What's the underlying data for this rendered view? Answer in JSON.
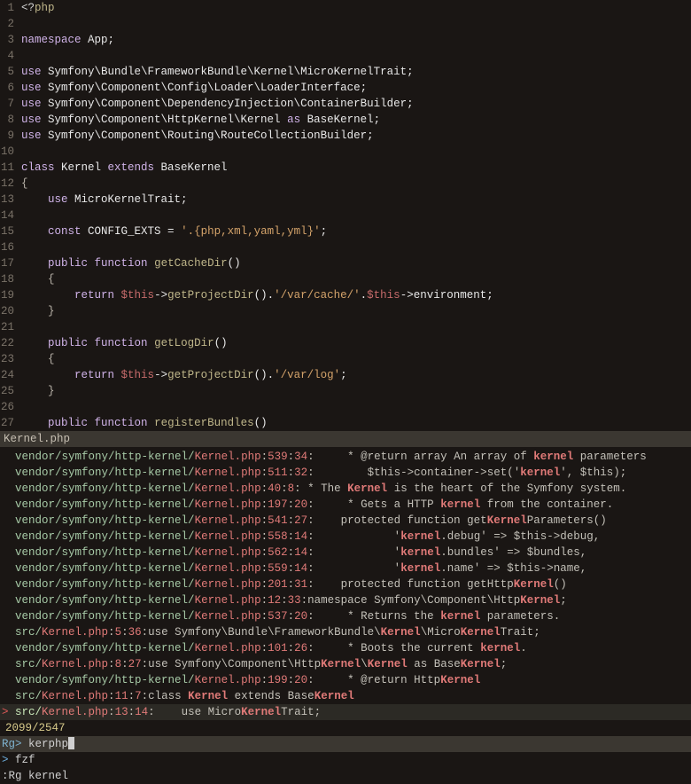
{
  "editor": {
    "lines": [
      {
        "n": "1",
        "segs": [
          {
            "c": "p",
            "t": "<?"
          },
          {
            "c": "fn",
            "t": "php"
          }
        ]
      },
      {
        "n": "2",
        "segs": []
      },
      {
        "n": "3",
        "segs": [
          {
            "c": "k",
            "t": "namespace"
          },
          {
            "c": "v",
            "t": " App;"
          }
        ]
      },
      {
        "n": "4",
        "segs": []
      },
      {
        "n": "5",
        "segs": [
          {
            "c": "k",
            "t": "use"
          },
          {
            "c": "v",
            "t": " Symfony\\Bundle\\FrameworkBundle\\Kernel\\MicroKernelTrait;"
          }
        ]
      },
      {
        "n": "6",
        "segs": [
          {
            "c": "k",
            "t": "use"
          },
          {
            "c": "v",
            "t": " Symfony\\Component\\Config\\Loader\\LoaderInterface;"
          }
        ]
      },
      {
        "n": "7",
        "segs": [
          {
            "c": "k",
            "t": "use"
          },
          {
            "c": "v",
            "t": " Symfony\\Component\\DependencyInjection\\ContainerBuilder;"
          }
        ]
      },
      {
        "n": "8",
        "segs": [
          {
            "c": "k",
            "t": "use"
          },
          {
            "c": "v",
            "t": " Symfony\\Component\\HttpKernel\\Kernel "
          },
          {
            "c": "k",
            "t": "as"
          },
          {
            "c": "v",
            "t": " BaseKernel;"
          }
        ]
      },
      {
        "n": "9",
        "segs": [
          {
            "c": "k",
            "t": "use"
          },
          {
            "c": "v",
            "t": " Symfony\\Component\\Routing\\RouteCollectionBuilder;"
          }
        ]
      },
      {
        "n": "10",
        "segs": []
      },
      {
        "n": "11",
        "segs": [
          {
            "c": "k",
            "t": "class"
          },
          {
            "c": "v",
            "t": " Kernel "
          },
          {
            "c": "k",
            "t": "extends"
          },
          {
            "c": "v",
            "t": " BaseKernel"
          }
        ]
      },
      {
        "n": "12",
        "segs": [
          {
            "c": "br",
            "t": "{"
          }
        ]
      },
      {
        "n": "13",
        "segs": [
          {
            "c": "v",
            "t": "    "
          },
          {
            "c": "k",
            "t": "use"
          },
          {
            "c": "v",
            "t": " MicroKernelTrait;"
          }
        ]
      },
      {
        "n": "14",
        "segs": []
      },
      {
        "n": "15",
        "segs": [
          {
            "c": "v",
            "t": "    "
          },
          {
            "c": "k",
            "t": "const"
          },
          {
            "c": "v",
            "t": " CONFIG_EXTS = "
          },
          {
            "c": "s",
            "t": "'.{php,xml,yaml,yml}'"
          },
          {
            "c": "v",
            "t": ";"
          }
        ]
      },
      {
        "n": "16",
        "segs": []
      },
      {
        "n": "17",
        "segs": [
          {
            "c": "v",
            "t": "    "
          },
          {
            "c": "k",
            "t": "public"
          },
          {
            "c": "v",
            "t": " "
          },
          {
            "c": "k",
            "t": "function"
          },
          {
            "c": "v",
            "t": " "
          },
          {
            "c": "fn",
            "t": "getCacheDir"
          },
          {
            "c": "v",
            "t": "()"
          }
        ]
      },
      {
        "n": "18",
        "segs": [
          {
            "c": "v",
            "t": "    "
          },
          {
            "c": "br",
            "t": "{"
          }
        ]
      },
      {
        "n": "19",
        "segs": [
          {
            "c": "v",
            "t": "        "
          },
          {
            "c": "k",
            "t": "return"
          },
          {
            "c": "v",
            "t": " "
          },
          {
            "c": "vr",
            "t": "$this"
          },
          {
            "c": "v",
            "t": "->"
          },
          {
            "c": "fn",
            "t": "getProjectDir"
          },
          {
            "c": "v",
            "t": "()."
          },
          {
            "c": "s",
            "t": "'/var/cache/'"
          },
          {
            "c": "v",
            "t": "."
          },
          {
            "c": "vr",
            "t": "$this"
          },
          {
            "c": "v",
            "t": "->environment;"
          }
        ]
      },
      {
        "n": "20",
        "segs": [
          {
            "c": "v",
            "t": "    "
          },
          {
            "c": "br",
            "t": "}"
          }
        ]
      },
      {
        "n": "21",
        "segs": []
      },
      {
        "n": "22",
        "segs": [
          {
            "c": "v",
            "t": "    "
          },
          {
            "c": "k",
            "t": "public"
          },
          {
            "c": "v",
            "t": " "
          },
          {
            "c": "k",
            "t": "function"
          },
          {
            "c": "v",
            "t": " "
          },
          {
            "c": "fn",
            "t": "getLogDir"
          },
          {
            "c": "v",
            "t": "()"
          }
        ]
      },
      {
        "n": "23",
        "segs": [
          {
            "c": "v",
            "t": "    "
          },
          {
            "c": "br",
            "t": "{"
          }
        ]
      },
      {
        "n": "24",
        "segs": [
          {
            "c": "v",
            "t": "        "
          },
          {
            "c": "k",
            "t": "return"
          },
          {
            "c": "v",
            "t": " "
          },
          {
            "c": "vr",
            "t": "$this"
          },
          {
            "c": "v",
            "t": "->"
          },
          {
            "c": "fn",
            "t": "getProjectDir"
          },
          {
            "c": "v",
            "t": "()."
          },
          {
            "c": "s",
            "t": "'/var/log'"
          },
          {
            "c": "v",
            "t": ";"
          }
        ]
      },
      {
        "n": "25",
        "segs": [
          {
            "c": "v",
            "t": "    "
          },
          {
            "c": "br",
            "t": "}"
          }
        ]
      },
      {
        "n": "26",
        "segs": []
      },
      {
        "n": "27",
        "segs": [
          {
            "c": "v",
            "t": "    "
          },
          {
            "c": "k",
            "t": "public"
          },
          {
            "c": "v",
            "t": " "
          },
          {
            "c": "k",
            "t": "function"
          },
          {
            "c": "v",
            "t": " "
          },
          {
            "c": "fn",
            "t": "registerBundles"
          },
          {
            "c": "v",
            "t": "()"
          }
        ]
      }
    ]
  },
  "filebar": "Kernel.php",
  "results": [
    {
      "dir": "vendor/symfony/http-kernel/",
      "file": "Kernel.php",
      "ln": "539",
      "col": "34",
      "segs": [
        {
          "t": "     * @return array An array of "
        },
        {
          "h": true,
          "t": "kernel"
        },
        {
          "t": " parameters"
        }
      ]
    },
    {
      "dir": "vendor/symfony/http-kernel/",
      "file": "Kernel.php",
      "ln": "511",
      "col": "32",
      "segs": [
        {
          "t": "        $this->container->set('"
        },
        {
          "h": true,
          "t": "kernel"
        },
        {
          "t": "', $this);"
        }
      ]
    },
    {
      "dir": "vendor/symfony/http-kernel/",
      "file": "Kernel.php",
      "ln": "40",
      "col": "8",
      "segs": [
        {
          "t": " * The "
        },
        {
          "h": true,
          "t": "Kernel"
        },
        {
          "t": " is the heart of the Symfony system."
        }
      ]
    },
    {
      "dir": "vendor/symfony/http-kernel/",
      "file": "Kernel.php",
      "ln": "197",
      "col": "20",
      "segs": [
        {
          "t": "     * Gets a HTTP "
        },
        {
          "h": true,
          "t": "kernel"
        },
        {
          "t": " from the container."
        }
      ]
    },
    {
      "dir": "vendor/symfony/http-kernel/",
      "file": "Kernel.php",
      "ln": "541",
      "col": "27",
      "segs": [
        {
          "t": "    protected function get"
        },
        {
          "h": true,
          "t": "Kernel"
        },
        {
          "t": "Parameters()"
        }
      ]
    },
    {
      "dir": "vendor/symfony/http-kernel/",
      "file": "Kernel.php",
      "ln": "558",
      "col": "14",
      "segs": [
        {
          "t": "            '"
        },
        {
          "h": true,
          "t": "kernel"
        },
        {
          "t": ".debug' => $this->debug,"
        }
      ]
    },
    {
      "dir": "vendor/symfony/http-kernel/",
      "file": "Kernel.php",
      "ln": "562",
      "col": "14",
      "segs": [
        {
          "t": "            '"
        },
        {
          "h": true,
          "t": "kernel"
        },
        {
          "t": ".bundles' => $bundles,"
        }
      ]
    },
    {
      "dir": "vendor/symfony/http-kernel/",
      "file": "Kernel.php",
      "ln": "559",
      "col": "14",
      "segs": [
        {
          "t": "            '"
        },
        {
          "h": true,
          "t": "kernel"
        },
        {
          "t": ".name' => $this->name,"
        }
      ]
    },
    {
      "dir": "vendor/symfony/http-kernel/",
      "file": "Kernel.php",
      "ln": "201",
      "col": "31",
      "segs": [
        {
          "t": "    protected function getHttp"
        },
        {
          "h": true,
          "t": "Kernel"
        },
        {
          "t": "()"
        }
      ]
    },
    {
      "dir": "vendor/symfony/http-kernel/",
      "file": "Kernel.php",
      "ln": "12",
      "col": "33",
      "segs": [
        {
          "t": "namespace Symfony\\Component\\Http"
        },
        {
          "h": true,
          "t": "Kernel"
        },
        {
          "t": ";"
        }
      ]
    },
    {
      "dir": "vendor/symfony/http-kernel/",
      "file": "Kernel.php",
      "ln": "537",
      "col": "20",
      "segs": [
        {
          "t": "     * Returns the "
        },
        {
          "h": true,
          "t": "kernel"
        },
        {
          "t": " parameters."
        }
      ]
    },
    {
      "dir": "src/",
      "file": "Kernel.php",
      "ln": "5",
      "col": "36",
      "segs": [
        {
          "t": "use Symfony\\Bundle\\FrameworkBundle\\"
        },
        {
          "h": true,
          "t": "Kernel"
        },
        {
          "t": "\\Micro"
        },
        {
          "h": true,
          "t": "Kernel"
        },
        {
          "t": "Trait;"
        }
      ]
    },
    {
      "dir": "vendor/symfony/http-kernel/",
      "file": "Kernel.php",
      "ln": "101",
      "col": "26",
      "segs": [
        {
          "t": "     * Boots the current "
        },
        {
          "h": true,
          "t": "kernel"
        },
        {
          "t": "."
        }
      ]
    },
    {
      "dir": "src/",
      "file": "Kernel.php",
      "ln": "8",
      "col": "27",
      "segs": [
        {
          "t": "use Symfony\\Component\\Http"
        },
        {
          "h": true,
          "t": "Kernel"
        },
        {
          "t": "\\"
        },
        {
          "h": true,
          "t": "Kernel"
        },
        {
          "t": " as Base"
        },
        {
          "h": true,
          "t": "Kernel"
        },
        {
          "t": ";"
        }
      ]
    },
    {
      "dir": "vendor/symfony/http-kernel/",
      "file": "Kernel.php",
      "ln": "199",
      "col": "20",
      "segs": [
        {
          "t": "     * @return Http"
        },
        {
          "h": true,
          "t": "Kernel"
        }
      ]
    },
    {
      "dir": "src/",
      "file": "Kernel.php",
      "ln": "11",
      "col": "7",
      "segs": [
        {
          "t": "class "
        },
        {
          "h": true,
          "t": "Kernel"
        },
        {
          "t": " extends Base"
        },
        {
          "h": true,
          "t": "Kernel"
        }
      ]
    }
  ],
  "selected": {
    "mark": ">",
    "dir": "src/",
    "file": "Kernel.php",
    "ln": "13",
    "col": "14",
    "segs": [
      {
        "t": "    use Micro"
      },
      {
        "h": true,
        "t": "Kernel"
      },
      {
        "t": "Trait;"
      }
    ]
  },
  "count": "2099/2547",
  "prompt_label": "Rg>",
  "prompt_value": "kerphp",
  "fzf_mark": ">",
  "fzf_label": "fzf",
  "cmd": ":Rg kernel"
}
